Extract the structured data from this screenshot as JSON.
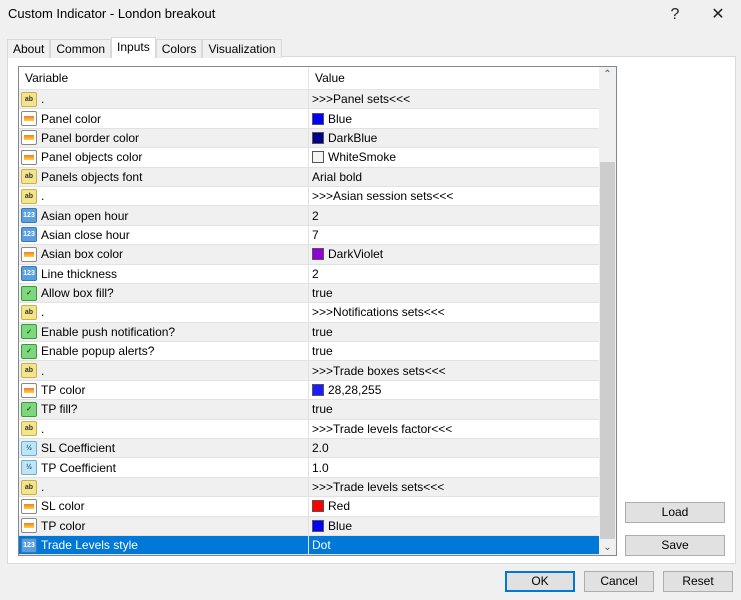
{
  "window": {
    "title": "Custom Indicator - London breakout",
    "help": "?",
    "close": "✕"
  },
  "tabs": [
    {
      "label": "About"
    },
    {
      "label": "Common"
    },
    {
      "label": "Inputs",
      "active": true
    },
    {
      "label": "Colors"
    },
    {
      "label": "Visualization"
    }
  ],
  "table": {
    "headers": [
      "Variable",
      "Value"
    ],
    "rows": [
      {
        "type": "ab",
        "variable": ".",
        "value": ">>>Panel sets<<<",
        "center": true
      },
      {
        "type": "color",
        "variable": "Panel color",
        "value": "Blue",
        "swatch": "#0000ff"
      },
      {
        "type": "color",
        "variable": "Panel border color",
        "value": "DarkBlue",
        "swatch": "#00008b"
      },
      {
        "type": "color",
        "variable": "Panel objects color",
        "value": "WhiteSmoke",
        "swatch": "#f5f5f5"
      },
      {
        "type": "ab",
        "variable": "Panels objects font",
        "value": "Arial bold"
      },
      {
        "type": "ab",
        "variable": ".",
        "value": ">>>Asian session sets<<<",
        "center": true
      },
      {
        "type": "int",
        "variable": "Asian open hour",
        "value": "2"
      },
      {
        "type": "int",
        "variable": "Asian close hour",
        "value": "7"
      },
      {
        "type": "color",
        "variable": "Asian box color",
        "value": "DarkViolet",
        "swatch": "#9400d3"
      },
      {
        "type": "int",
        "variable": "Line thickness",
        "value": "2"
      },
      {
        "type": "bool",
        "variable": "Allow box fill?",
        "value": "true"
      },
      {
        "type": "ab",
        "variable": ".",
        "value": ">>>Notifications sets<<<",
        "center": true
      },
      {
        "type": "bool",
        "variable": "Enable push notification?",
        "value": "true"
      },
      {
        "type": "bool",
        "variable": "Enable popup alerts?",
        "value": "true"
      },
      {
        "type": "ab",
        "variable": ".",
        "value": ">>>Trade boxes sets<<<",
        "center": true
      },
      {
        "type": "color",
        "variable": "TP color",
        "value": "28,28,255",
        "swatch": "#1c1cff"
      },
      {
        "type": "bool",
        "variable": "TP fill?",
        "value": "true"
      },
      {
        "type": "ab",
        "variable": ".",
        "value": ">>>Trade levels factor<<<",
        "center": true
      },
      {
        "type": "double",
        "variable": "SL Coefficient",
        "value": "2.0"
      },
      {
        "type": "double",
        "variable": "TP Coefficient",
        "value": "1.0"
      },
      {
        "type": "ab",
        "variable": ".",
        "value": ">>>Trade levels sets<<<",
        "center": true
      },
      {
        "type": "color",
        "variable": "SL color",
        "value": "Red",
        "swatch": "#ff0000"
      },
      {
        "type": "color",
        "variable": "TP color",
        "value": "Blue",
        "swatch": "#0000ff"
      },
      {
        "type": "int",
        "variable": "Trade Levels style",
        "value": "Dot",
        "selected": true
      }
    ]
  },
  "buttons": {
    "load": "Load",
    "save": "Save",
    "ok": "OK",
    "cancel": "Cancel",
    "reset": "Reset"
  },
  "colors": {
    "selection": "#0078d7"
  }
}
